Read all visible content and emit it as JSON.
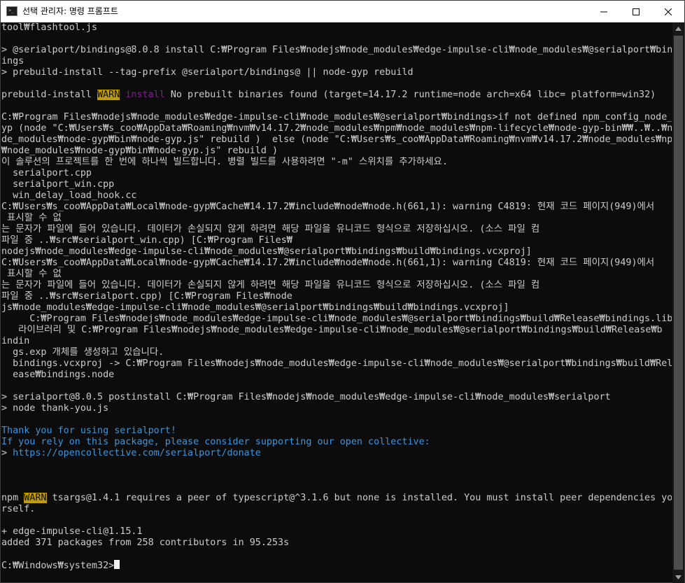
{
  "window": {
    "title": "선택 관리자: 명령 프롬프트",
    "app_icon": "cmd-icon",
    "app_icon_text": ">_",
    "controls": {
      "minimize_icon": "minimize-icon",
      "maximize_icon": "maximize-icon",
      "close_icon": "close-icon"
    }
  },
  "colors": {
    "background": "#0c0c0c",
    "foreground": "#cccccc",
    "cyan": "#3a96dd",
    "magenta": "#881798",
    "warn_bg": "#c19c00",
    "titlebar": "#ffffff",
    "scrollbar_track": "#171717",
    "scrollbar_thumb": "#4d4d4d"
  },
  "terminal": {
    "lines": [
      {
        "segments": [
          {
            "text": "tool₩flashtool.js"
          }
        ]
      },
      {
        "segments": [
          {
            "text": ""
          }
        ]
      },
      {
        "segments": [
          {
            "text": "> @serialport/bindings@8.0.8 install C:₩Program Files₩nodejs₩node_modules₩edge-impulse-cli₩node_modules₩@serialport₩bind"
          }
        ]
      },
      {
        "segments": [
          {
            "text": "ings"
          }
        ]
      },
      {
        "segments": [
          {
            "text": "> prebuild-install --tag-prefix @serialport/bindings@ || node-gyp rebuild"
          }
        ]
      },
      {
        "segments": [
          {
            "text": ""
          }
        ]
      },
      {
        "segments": [
          {
            "text": "prebuild-install "
          },
          {
            "text": "WARN",
            "style": "warn"
          },
          {
            "text": " "
          },
          {
            "text": "install",
            "style": "magenta"
          },
          {
            "text": " No prebuilt binaries found (target=14.17.2 runtime=node arch=x64 libc= platform=win32)"
          }
        ]
      },
      {
        "segments": [
          {
            "text": ""
          }
        ]
      },
      {
        "segments": [
          {
            "text": "C:₩Program Files₩nodejs₩node_modules₩edge-impulse-cli₩node_modules₩@serialport₩bindings>if not defined npm_config_node_g"
          }
        ]
      },
      {
        "segments": [
          {
            "text": "yp (node \"C:₩Users₩s_coo₩AppData₩Roaming₩nvm₩v14.17.2₩node_modules₩npm₩node_modules₩npm-lifecycle₩node-gyp-bin₩₩..₩..₩no"
          }
        ]
      },
      {
        "segments": [
          {
            "text": "de_modules₩node-gyp₩bin₩node-gyp.js\" rebuild )  else (node \"C:₩Users₩s_coo₩AppData₩Roaming₩nvm₩v14.17.2₩node_modules₩npm"
          }
        ]
      },
      {
        "segments": [
          {
            "text": "₩node_modules₩node-gyp₩bin₩node-gyp.js\" rebuild )"
          }
        ]
      },
      {
        "segments": [
          {
            "text": "이 솔루션의 프로젝트를 한 번에 하나씩 빌드합니다. 병렬 빌드를 사용하려면 \"-m\" 스위치를 추가하세요."
          }
        ]
      },
      {
        "segments": [
          {
            "text": "  serialport.cpp"
          }
        ]
      },
      {
        "segments": [
          {
            "text": "  serialport_win.cpp"
          }
        ]
      },
      {
        "segments": [
          {
            "text": "  win_delay_load_hook.cc"
          }
        ]
      },
      {
        "segments": [
          {
            "text": "C:₩Users₩s_coo₩AppData₩Local₩node-gyp₩Cache₩14.17.2₩include₩node₩node.h(661,1): warning C4819: 현재 코드 페이지(949)에서"
          }
        ]
      },
      {
        "segments": [
          {
            "text": " 표시할 수 없"
          }
        ]
      },
      {
        "segments": [
          {
            "text": "는 문자가 파일에 들어 있습니다. 데이터가 손실되지 않게 하려면 해당 파일을 유니코드 형식으로 저장하십시오. (소스 파일 컴"
          }
        ]
      },
      {
        "segments": [
          {
            "text": "파일 중 ..₩src₩serialport_win.cpp) [C:₩Program Files₩"
          }
        ]
      },
      {
        "segments": [
          {
            "text": "nodejs₩node_modules₩edge-impulse-cli₩node_modules₩@serialport₩bindings₩build₩bindings.vcxproj]"
          }
        ]
      },
      {
        "segments": [
          {
            "text": "C:₩Users₩s_coo₩AppData₩Local₩node-gyp₩Cache₩14.17.2₩include₩node₩node.h(661,1): warning C4819: 현재 코드 페이지(949)에서"
          }
        ]
      },
      {
        "segments": [
          {
            "text": " 표시할 수 없"
          }
        ]
      },
      {
        "segments": [
          {
            "text": "는 문자가 파일에 들어 있습니다. 데이터가 손실되지 않게 하려면 해당 파일을 유니코드 형식으로 저장하십시오. (소스 파일 컴"
          }
        ]
      },
      {
        "segments": [
          {
            "text": "파일 중 ..₩src₩serialport.cpp) [C:₩Program Files₩node"
          }
        ]
      },
      {
        "segments": [
          {
            "text": "js₩node_modules₩edge-impulse-cli₩node_modules₩@serialport₩bindings₩build₩bindings.vcxproj]"
          }
        ]
      },
      {
        "segments": [
          {
            "text": "     C:₩Program Files₩nodejs₩node_modules₩edge-impulse-cli₩node_modules₩@serialport₩bindings₩build₩Release₩bindings.lib"
          }
        ]
      },
      {
        "segments": [
          {
            "text": "   라이브러리 및 C:₩Program Files₩nodejs₩node_modules₩edge-impulse-cli₩node_modules₩@serialport₩bindings₩build₩Release₩b"
          }
        ]
      },
      {
        "segments": [
          {
            "text": "indin"
          }
        ]
      },
      {
        "segments": [
          {
            "text": "  gs.exp 개체를 생성하고 있습니다."
          }
        ]
      },
      {
        "segments": [
          {
            "text": "  bindings.vcxproj -> C:₩Program Files₩nodejs₩node_modules₩edge-impulse-cli₩node_modules₩@serialport₩bindings₩build₩Rel"
          }
        ]
      },
      {
        "segments": [
          {
            "text": "  ease₩bindings.node"
          }
        ]
      },
      {
        "segments": [
          {
            "text": ""
          }
        ]
      },
      {
        "segments": [
          {
            "text": "> serialport@8.0.5 postinstall C:₩Program Files₩nodejs₩node_modules₩edge-impulse-cli₩node_modules₩serialport"
          }
        ]
      },
      {
        "segments": [
          {
            "text": "> node thank-you.js"
          }
        ]
      },
      {
        "segments": [
          {
            "text": ""
          }
        ]
      },
      {
        "segments": [
          {
            "text": "Thank you for using serialport!",
            "style": "cyan"
          }
        ]
      },
      {
        "segments": [
          {
            "text": "If you rely on this package, please consider supporting our open collective:",
            "style": "cyan"
          }
        ]
      },
      {
        "segments": [
          {
            "text": "> "
          },
          {
            "text": "https://opencollective.com/serialport/donate",
            "style": "link"
          }
        ]
      },
      {
        "segments": [
          {
            "text": ""
          }
        ]
      },
      {
        "segments": [
          {
            "text": ""
          }
        ]
      },
      {
        "segments": [
          {
            "text": ""
          }
        ]
      },
      {
        "segments": [
          {
            "text": "npm "
          },
          {
            "text": "WARN",
            "style": "warn"
          },
          {
            "text": " tsargs@1.4.1 requires a peer of typescript@^3.1.6 but none is installed. You must install peer dependencies you"
          }
        ]
      },
      {
        "segments": [
          {
            "text": "rself."
          }
        ]
      },
      {
        "segments": [
          {
            "text": ""
          }
        ]
      },
      {
        "segments": [
          {
            "text": "+ edge-impulse-cli@1.15.1"
          }
        ]
      },
      {
        "segments": [
          {
            "text": "added 371 packages from 258 contributors in 95.253s"
          }
        ]
      },
      {
        "segments": [
          {
            "text": ""
          }
        ]
      },
      {
        "segments": [
          {
            "text": "C:₩Windows₩system32>"
          }
        ],
        "cursor": true
      }
    ]
  },
  "scrollbar": {
    "up_icon": "scroll-up-arrow-icon",
    "down_icon": "scroll-down-arrow-icon"
  }
}
